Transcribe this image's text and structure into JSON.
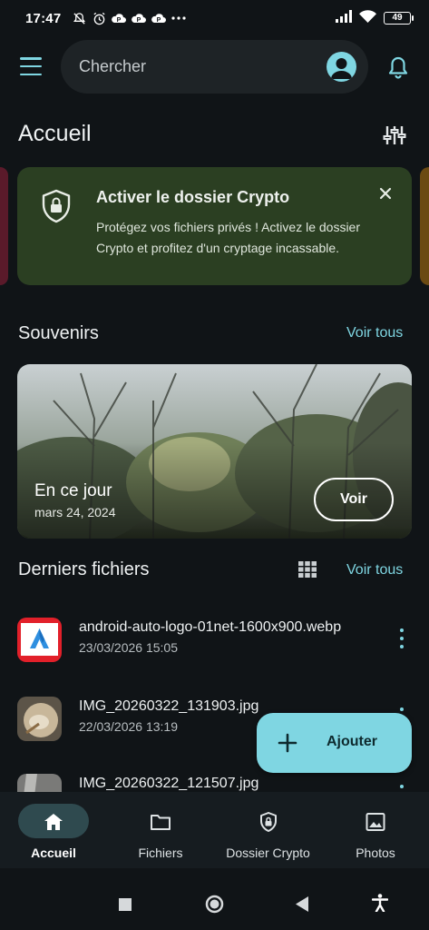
{
  "status_bar": {
    "time": "17:47",
    "battery": "49",
    "icons": [
      "mute-icon",
      "alarm-icon",
      "p-notification-icon",
      "p-notification-icon",
      "p-notification-icon",
      "more-dots-icon",
      "signal-icon",
      "wifi-icon",
      "battery-icon"
    ]
  },
  "header": {
    "search_placeholder": "Chercher"
  },
  "page": {
    "title": "Accueil"
  },
  "crypto_banner": {
    "title": "Activer le dossier Crypto",
    "text": "Protégez vos fichiers privés ! Activez le dossier Crypto et profitez d'un cryptage incassable."
  },
  "memories": {
    "section_title": "Souvenirs",
    "see_all": "Voir tous",
    "card_title": "En ce jour",
    "card_date": "mars 24, 2024",
    "card_button": "Voir"
  },
  "recent_files": {
    "section_title": "Derniers fichiers",
    "see_all": "Voir tous",
    "items": [
      {
        "name": "android-auto-logo-01net-1600x900.webp",
        "date": "23/03/2026 15:05"
      },
      {
        "name": "IMG_20260322_131903.jpg",
        "date": "22/03/2026 13:19"
      },
      {
        "name": "IMG_20260322_121507.jpg",
        "date": ""
      }
    ]
  },
  "fab": {
    "label": "Ajouter"
  },
  "bottom_nav": {
    "items": [
      {
        "label": "Accueil",
        "icon": "home-icon",
        "active": true
      },
      {
        "label": "Fichiers",
        "icon": "folder-icon",
        "active": false
      },
      {
        "label": "Dossier Crypto",
        "icon": "shield-lock-icon",
        "active": false
      },
      {
        "label": "Photos",
        "icon": "image-icon",
        "active": false
      }
    ]
  },
  "colors": {
    "background": "#101417",
    "accent": "#7fd6e2",
    "crypto_card": "#2b3f22",
    "surface": "#1e2326"
  }
}
